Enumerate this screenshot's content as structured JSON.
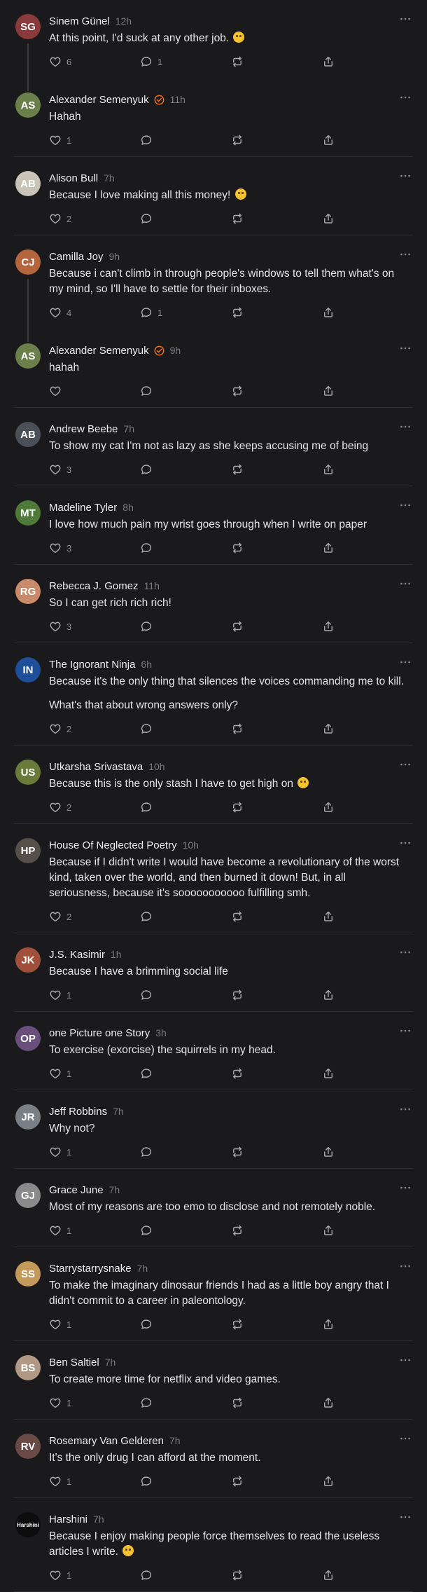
{
  "colors": {
    "background": "#1a1a1c",
    "accent_verified": "#f26d21",
    "muted": "#7b7b80",
    "icon": "#a9a9ae"
  },
  "icons": {
    "more": "ellipsis-icon",
    "like": "heart-icon",
    "reply": "comment-bubble-icon",
    "restack": "restack-icon",
    "share": "share-icon",
    "verified": "verified-check-icon"
  },
  "comments": [
    {
      "name": "Sinem Günel",
      "time": "12h",
      "verified": false,
      "paragraphs": [
        "At this point, I'd suck at any other job."
      ],
      "emoji": true,
      "likes": "6",
      "replies": "1",
      "avatar_color": "#8a3a3a",
      "avatar_initials": "SG",
      "thread_next": true
    },
    {
      "name": "Alexander Semenyuk",
      "time": "11h",
      "verified": true,
      "paragraphs": [
        "Hahah"
      ],
      "emoji": false,
      "likes": "1",
      "replies": "",
      "avatar_color": "#6b7f4a",
      "avatar_initials": "AS",
      "thread_next": false
    },
    {
      "name": "Alison Bull",
      "time": "7h",
      "verified": false,
      "paragraphs": [
        "Because I love making all this money!"
      ],
      "emoji": true,
      "likes": "2",
      "replies": "",
      "avatar_color": "#c9c3b8",
      "avatar_initials": "AB",
      "thread_next": false
    },
    {
      "name": "Camilla Joy",
      "time": "9h",
      "verified": false,
      "paragraphs": [
        "Because i can't climb in through people's windows to tell them what's on my mind, so I'll have to settle for their inboxes."
      ],
      "emoji": false,
      "likes": "4",
      "replies": "1",
      "avatar_color": "#b5653e",
      "avatar_initials": "CJ",
      "thread_next": true
    },
    {
      "name": "Alexander Semenyuk",
      "time": "9h",
      "verified": true,
      "paragraphs": [
        "hahah"
      ],
      "emoji": false,
      "likes": "",
      "replies": "",
      "avatar_color": "#6b7f4a",
      "avatar_initials": "AS",
      "thread_next": false
    },
    {
      "name": "Andrew Beebe",
      "time": "7h",
      "verified": false,
      "paragraphs": [
        "To show my cat I'm not as lazy as she keeps accusing me of being"
      ],
      "emoji": false,
      "likes": "3",
      "replies": "",
      "avatar_color": "#4b4f58",
      "avatar_initials": "AB",
      "thread_next": false
    },
    {
      "name": "Madeline Tyler",
      "time": "8h",
      "verified": false,
      "paragraphs": [
        "I love how much pain my wrist goes through when I write on paper"
      ],
      "emoji": false,
      "likes": "3",
      "replies": "",
      "avatar_color": "#4f7a3a",
      "avatar_initials": "MT",
      "thread_next": false
    },
    {
      "name": "Rebecca J. Gomez",
      "time": "11h",
      "verified": false,
      "paragraphs": [
        "So I can get rich rich rich!"
      ],
      "emoji": false,
      "likes": "3",
      "replies": "",
      "avatar_color": "#c88a6a",
      "avatar_initials": "RG",
      "thread_next": false
    },
    {
      "name": "The Ignorant Ninja",
      "time": "6h",
      "verified": false,
      "paragraphs": [
        "Because it's the only thing that silences the voices commanding me to kill.",
        "What's that about wrong answers only?"
      ],
      "emoji": false,
      "likes": "2",
      "replies": "",
      "avatar_color": "#1f4f9a",
      "avatar_initials": "IN",
      "thread_next": false
    },
    {
      "name": "Utkarsha Srivastava",
      "time": "10h",
      "verified": false,
      "paragraphs": [
        "Because this is the only stash I have to get high on"
      ],
      "emoji": true,
      "likes": "2",
      "replies": "",
      "avatar_color": "#6a7a3a",
      "avatar_initials": "US",
      "thread_next": false
    },
    {
      "name": "House Of Neglected Poetry",
      "time": "10h",
      "verified": false,
      "paragraphs": [
        "Because if I didn't write I would have become a revolutionary of the worst kind, taken over the world, and then burned it down! But, in all seriousness, because it's sooooooooooo fulfilling smh."
      ],
      "emoji": false,
      "likes": "2",
      "replies": "",
      "avatar_color": "#55504a",
      "avatar_initials": "HP",
      "thread_next": false
    },
    {
      "name": "J.S. Kasimir",
      "time": "1h",
      "verified": false,
      "paragraphs": [
        "Because I have a brimming social life"
      ],
      "emoji": false,
      "likes": "1",
      "replies": "",
      "avatar_color": "#a0503a",
      "avatar_initials": "JK",
      "thread_next": false
    },
    {
      "name": "one Picture one Story",
      "time": "3h",
      "verified": false,
      "paragraphs": [
        "To exercise (exorcise) the squirrels in my head."
      ],
      "emoji": false,
      "likes": "1",
      "replies": "",
      "avatar_color": "#6a4f7a",
      "avatar_initials": "OP",
      "thread_next": false
    },
    {
      "name": "Jeff Robbins",
      "time": "7h",
      "verified": false,
      "paragraphs": [
        "Why not?"
      ],
      "emoji": false,
      "likes": "1",
      "replies": "",
      "avatar_color": "#7a7f86",
      "avatar_initials": "JR",
      "thread_next": false
    },
    {
      "name": "Grace June",
      "time": "7h",
      "verified": false,
      "paragraphs": [
        "Most of my reasons are too emo to disclose and not remotely noble."
      ],
      "emoji": false,
      "likes": "1",
      "replies": "",
      "avatar_color": "#8a8a8a",
      "avatar_initials": "GJ",
      "thread_next": false
    },
    {
      "name": "Starrystarrysnake",
      "time": "7h",
      "verified": false,
      "paragraphs": [
        "To make the imaginary dinosaur friends I had as a little boy angry that I didn't commit to a career in paleontology."
      ],
      "emoji": false,
      "likes": "1",
      "replies": "",
      "avatar_color": "#c49a5a",
      "avatar_initials": "SS",
      "thread_next": false
    },
    {
      "name": "Ben Saltiel",
      "time": "7h",
      "verified": false,
      "paragraphs": [
        "To create more time for netflix and video games."
      ],
      "emoji": false,
      "likes": "1",
      "replies": "",
      "avatar_color": "#b09a86",
      "avatar_initials": "BS",
      "thread_next": false
    },
    {
      "name": "Rosemary Van Gelderen",
      "time": "7h",
      "verified": false,
      "paragraphs": [
        "It's the only drug I can afford at the moment."
      ],
      "emoji": false,
      "likes": "1",
      "replies": "",
      "avatar_color": "#6a4a44",
      "avatar_initials": "RV",
      "thread_next": false
    },
    {
      "name": "Harshini",
      "time": "7h",
      "verified": false,
      "paragraphs": [
        "Because I enjoy making people force themselves to read the useless articles I write."
      ],
      "emoji": true,
      "likes": "1",
      "replies": "",
      "avatar_color": "#0d0d0d",
      "avatar_initials": "Harshini",
      "thread_next": false
    }
  ]
}
